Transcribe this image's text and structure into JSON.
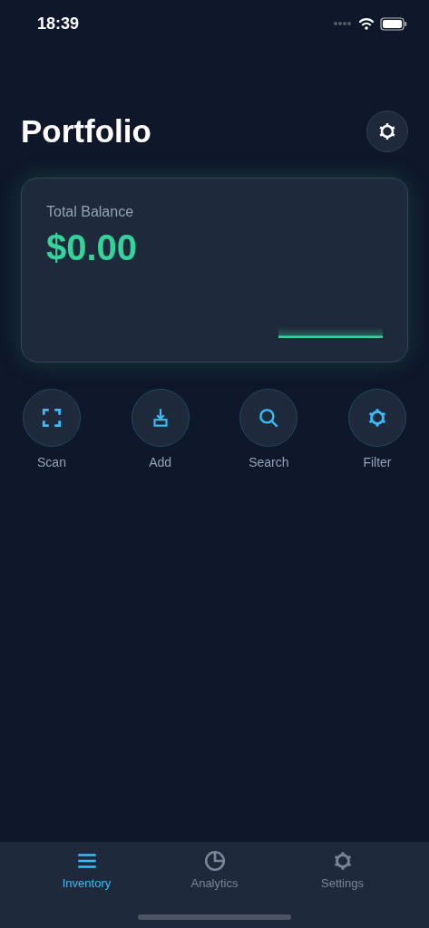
{
  "status_bar": {
    "time": "18:39"
  },
  "header": {
    "title": "Portfolio"
  },
  "balance_card": {
    "label": "Total Balance",
    "value": "$0.00"
  },
  "actions": [
    {
      "kind": "scan",
      "label": "Scan"
    },
    {
      "kind": "add",
      "label": "Add"
    },
    {
      "kind": "search",
      "label": "Search"
    },
    {
      "kind": "filter",
      "label": "Filter"
    }
  ],
  "tab_bar": [
    {
      "kind": "list",
      "label": "Inventory",
      "selected": true
    },
    {
      "kind": "chart",
      "label": "Analytics",
      "selected": false
    },
    {
      "kind": "gear",
      "label": "Settings",
      "selected": false
    }
  ]
}
